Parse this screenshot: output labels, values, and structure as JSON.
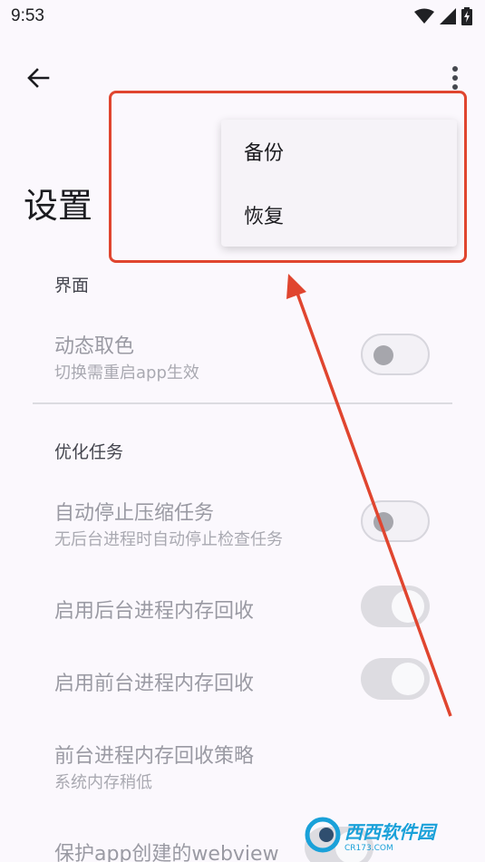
{
  "status_bar": {
    "time": "9:53"
  },
  "page": {
    "title": "设置"
  },
  "menu": {
    "items": [
      {
        "label": "备份"
      },
      {
        "label": "恢复"
      }
    ]
  },
  "sections": [
    {
      "header": "界面",
      "prefs": [
        {
          "title": "动态取色",
          "summary": "切换需重启app生效",
          "switch": "off"
        }
      ]
    },
    {
      "header": "优化任务",
      "prefs": [
        {
          "title": "自动停止压缩任务",
          "summary": "无后台进程时自动停止检查任务",
          "switch": "off"
        },
        {
          "title": "启用后台进程内存回收",
          "summary": "",
          "switch": "on"
        },
        {
          "title": "启用前台进程内存回收",
          "summary": "",
          "switch": "on"
        },
        {
          "title": "前台进程内存回收策略",
          "summary": "系统内存稍低"
        },
        {
          "title": "保护app创建的webview",
          "summary": ""
        }
      ]
    }
  ],
  "annotation_colors": {
    "highlight": "#e0452f"
  },
  "watermark": {
    "text": "西西软件园",
    "sub": "CR173.COM"
  }
}
